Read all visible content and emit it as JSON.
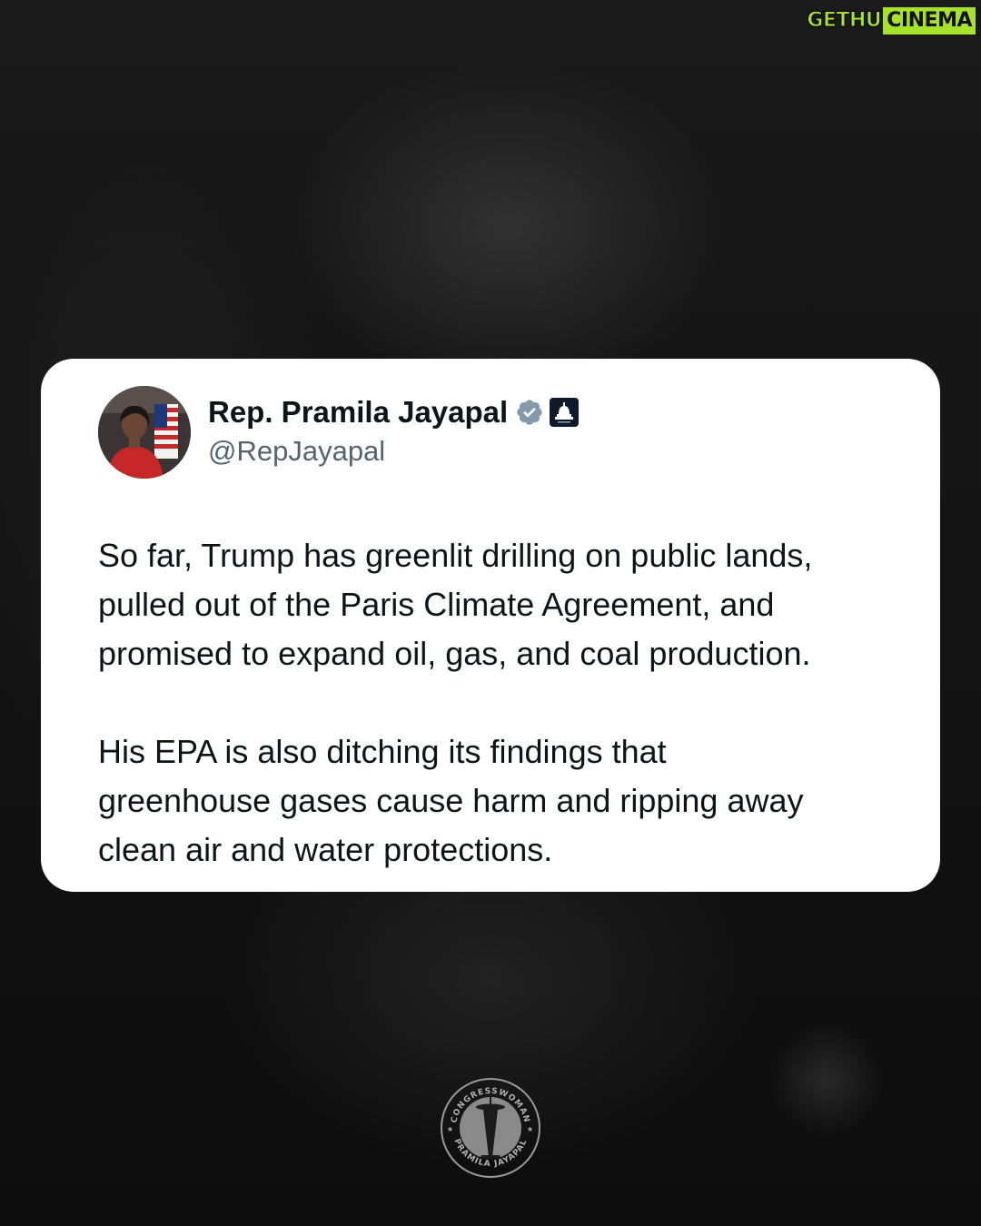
{
  "watermark": {
    "part1": "GETHU",
    "part2": "CINEMA"
  },
  "post": {
    "display_name": "Rep. Pramila Jayapal",
    "handle": "@RepJayapal",
    "paragraphs": [
      "So far, Trump has greenlit drilling on public lands,\npulled out of the Paris Climate Agreement, and\npromised to expand oil, gas, and coal production.",
      "His EPA is also ditching its findings that\ngreenhouse gases cause harm and ripping away\nclean air and water protections."
    ],
    "badges": [
      "verified-gray-icon",
      "government-capitol-icon"
    ]
  },
  "seal": {
    "top_text": "CONGRESSWOMAN",
    "bottom_text": "PRAMILA JAYAPAL"
  },
  "colors": {
    "accent_green": "#a7e22a",
    "badge_gray": "#829aab",
    "gov_badge_bg": "#0f1b2d",
    "text": "#0f1419",
    "handle": "#536471"
  }
}
